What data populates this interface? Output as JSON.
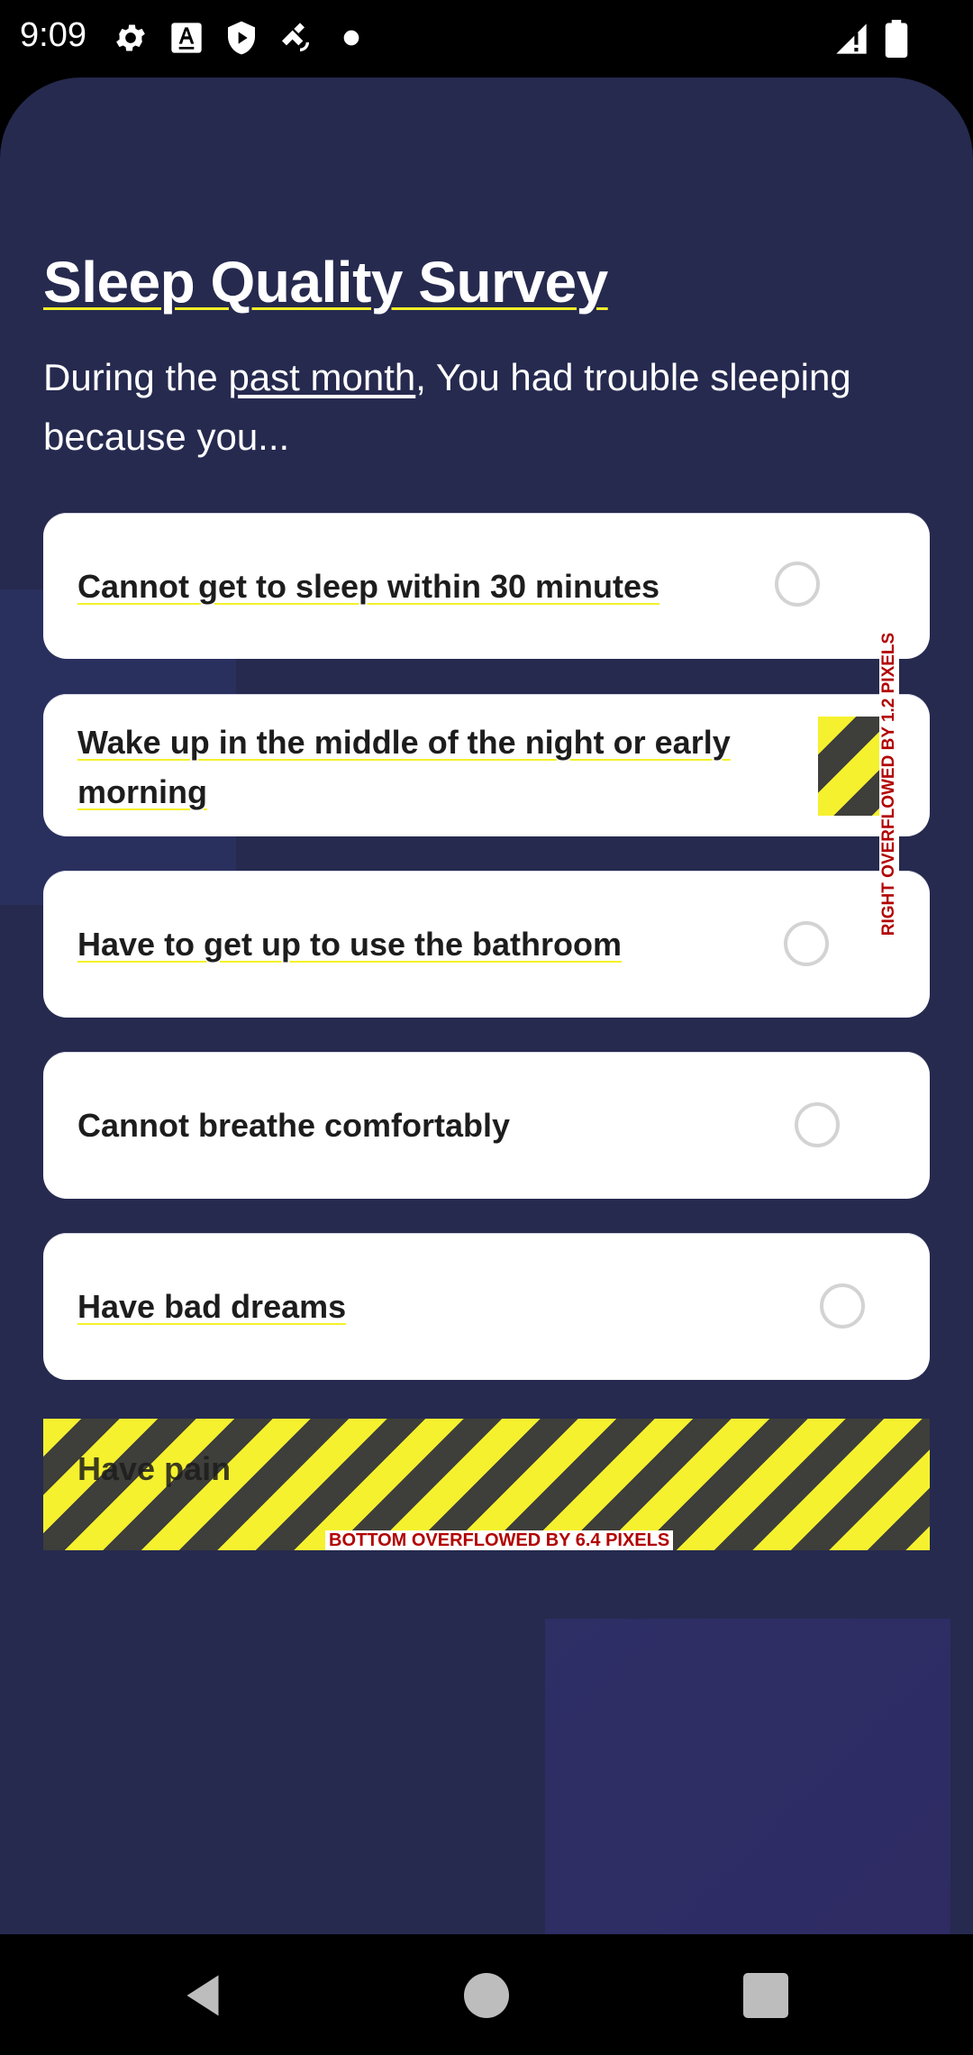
{
  "status_bar": {
    "time": "9:09"
  },
  "survey": {
    "title": "Sleep Quality Survey",
    "subtitle_before": "During the ",
    "subtitle_link": "past month",
    "subtitle_after": ", You had trouble sleeping because you..."
  },
  "options": [
    {
      "label": "Cannot get to sleep within 30 minutes"
    },
    {
      "label": "Wake up in the middle of the night or early morning"
    },
    {
      "label": "Have to get up to use the bathroom"
    },
    {
      "label": "Cannot breathe comfortably"
    },
    {
      "label": "Have bad dreams"
    },
    {
      "label": "Have pain"
    }
  ],
  "overflow": {
    "right_text": "RIGHT OVERFLOWED BY 1.2 PIXELS",
    "bottom_text": "BOTTOM OVERFLOWED BY 6.4 PIXELS"
  }
}
